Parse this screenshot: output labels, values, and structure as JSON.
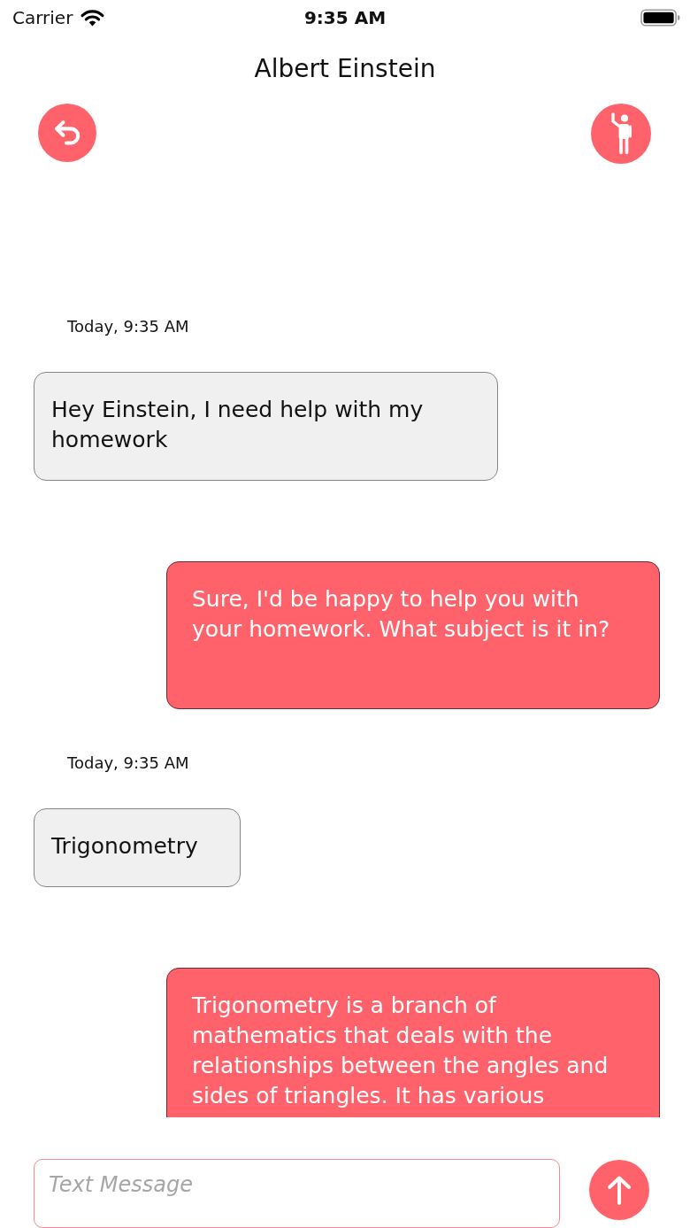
{
  "status_bar": {
    "carrier": "Carrier",
    "time": "9:35 AM"
  },
  "header": {
    "title": "Albert Einstein"
  },
  "messages": [
    {
      "kind": "timestamp",
      "text": "Today, 9:35 AM"
    },
    {
      "kind": "user",
      "text": "Hey Einstein, I need help with my homework"
    },
    {
      "kind": "bot",
      "text": "Sure, I'd be happy to help you with your homework. What subject is it in?"
    },
    {
      "kind": "timestamp",
      "text": "Today, 9:35 AM"
    },
    {
      "kind": "user",
      "text": "Trigonometry"
    },
    {
      "kind": "bot",
      "text": "Trigonometry is a branch of mathematics that deals with the relationships between the angles and sides of triangles. It has various"
    }
  ],
  "composer": {
    "placeholder": "Text Message"
  }
}
